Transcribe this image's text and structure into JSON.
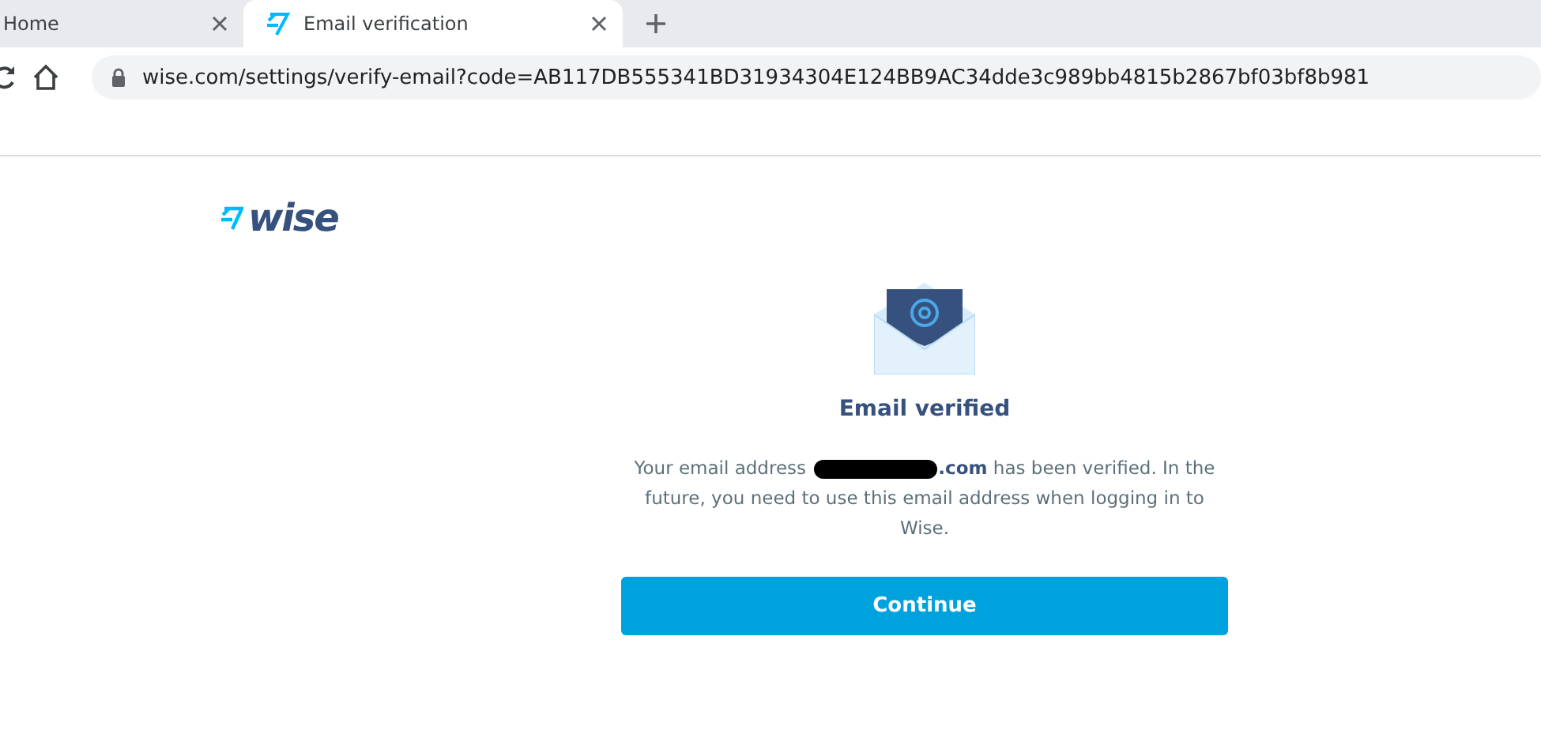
{
  "browser": {
    "tabs": [
      {
        "title": "Home",
        "selected": false,
        "has_favicon": false
      },
      {
        "title": "Email verification",
        "selected": true,
        "has_favicon": true
      }
    ],
    "address": "wise.com/settings/verify-email?code=AB117DB555341BD31934304E124BB9AC34dde3c989bb4815b2867bf03bf8b981"
  },
  "page": {
    "logo": "wise",
    "title": "Email verified",
    "message_before": "Your email address",
    "email_visible": ".com",
    "message_after": "has been verified. In the future, you need to use this email address when logging in to Wise.",
    "button": "Continue"
  }
}
